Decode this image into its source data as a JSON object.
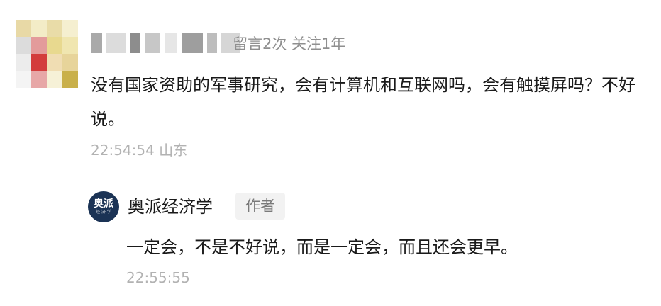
{
  "comment": {
    "meta": "留言2次 关注1年",
    "text": "没有国家资助的军事研究，会有计算机和互联网吗，会有触摸屏吗？不好说。",
    "time": "22:54:54 山东",
    "avatar_colors": [
      "#e8d9a6",
      "#f3ecc7",
      "#e9dca8",
      "#f5efd0",
      "#dcdcdc",
      "#e39b9b",
      "#e8d98f",
      "#f0e6b0",
      "#ececec",
      "#d33c3c",
      "#f0ddb3",
      "#e7d49a",
      "#f4f4f4",
      "#e7a7a7",
      "#f6f1d7",
      "#c9b04a"
    ],
    "name_blocks": [
      "#a9a9a9",
      "#dcdcdc",
      "#8d8d8d",
      "#c7c7c7",
      "#e6e6e6",
      "#9e9e9e",
      "#bdbdbd",
      "#d6d6d6"
    ]
  },
  "reply": {
    "author_name": "奥派经济学",
    "logo_text": "奥派",
    "logo_sub": "经 济 学",
    "badge": "作者",
    "text": "一定会，不是不好说，而是一定会，而且还会更早。",
    "time": "22:55:55"
  }
}
